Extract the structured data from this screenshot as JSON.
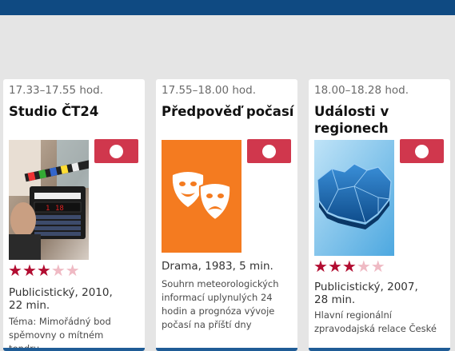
{
  "cards": [
    {
      "time": "17.33–17.55 hod.",
      "title": "Studio ČT24",
      "rating": 3,
      "rating_max": 5,
      "genre": "Publicistický, 2010, 22 min.",
      "description": "Téma: Mimořádný bod spěmovny o mítném tendru",
      "thumbnail_icon": "film-clapperboard-photo"
    },
    {
      "time": "17.55–18.00 hod.",
      "title": "Předpověď počasí",
      "genre": "Drama, 1983, 5 min.",
      "description": "Souhrn meteorologických informací uplynulých 24 hodin a prognóza vývoje počasí na příští dny",
      "thumbnail_icon": "theater-masks-icon",
      "accent": "#f47b20"
    },
    {
      "time": "18.00–18.28 hod.",
      "title": "Události v regionech",
      "rating": 3,
      "rating_max": 5,
      "genre": "Publicistický, 2007, 28 min.",
      "description": "Hlavní regionální zpravodajská relace České",
      "thumbnail_icon": "czech-map-photo"
    }
  ]
}
